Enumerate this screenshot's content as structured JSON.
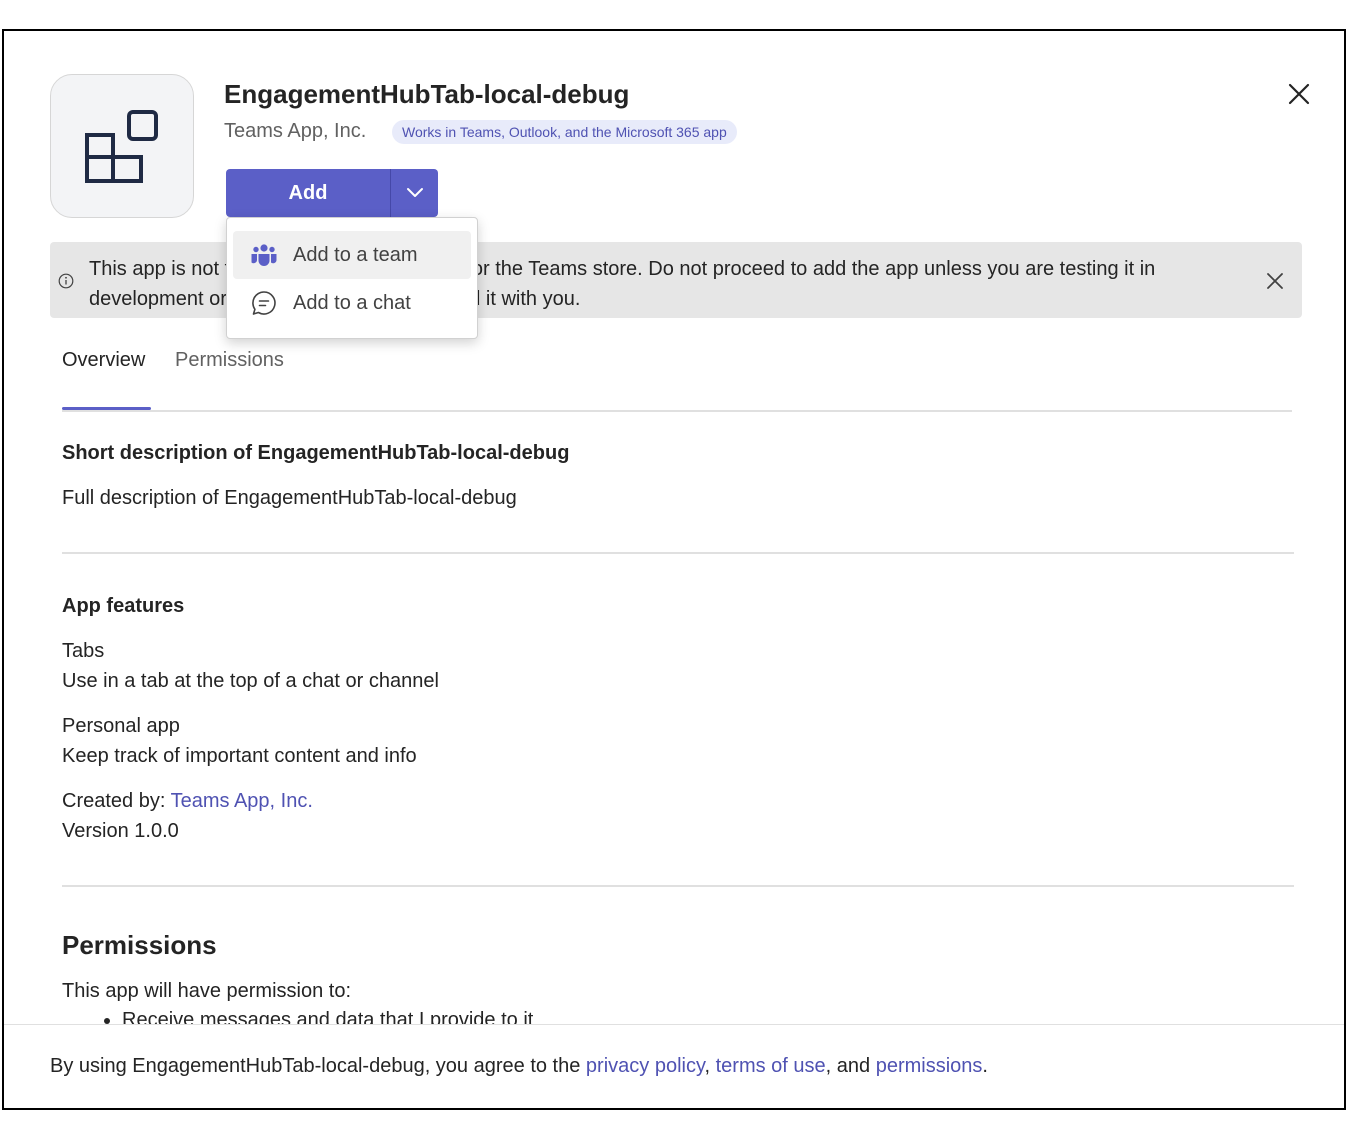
{
  "app": {
    "title": "EngagementHubTab-local-debug",
    "publisher": "Teams App, Inc.",
    "badge": "Works in Teams, Outlook, and the Microsoft 365 app",
    "icon": "app-grid-icon"
  },
  "actions": {
    "add_label": "Add",
    "dropdown_icon": "chevron-down-icon",
    "close_icon": "close-icon"
  },
  "menu": {
    "items": [
      {
        "label": "Add to a team",
        "icon": "team-icon"
      },
      {
        "label": "Add to a chat",
        "icon": "chat-icon"
      }
    ]
  },
  "banner": {
    "text": "This app is not from your org's app catalog or the Teams store. Do not proceed to add the app unless you are testing it in development or trust the person who shared it with you.",
    "icon": "info-icon",
    "close_icon": "close-icon"
  },
  "tabs": [
    {
      "label": "Overview",
      "selected": true
    },
    {
      "label": "Permissions",
      "selected": false
    }
  ],
  "overview": {
    "short_description": "Short description of EngagementHubTab-local-debug",
    "full_description": "Full description of EngagementHubTab-local-debug",
    "features_heading": "App features",
    "features": [
      {
        "name": "Tabs",
        "description": "Use in a tab at the top of a chat or channel"
      },
      {
        "name": "Personal app",
        "description": "Keep track of important content and info"
      }
    ],
    "created_by_label": "Created by:",
    "created_by_value": "Teams App, Inc.",
    "version": "Version 1.0.0"
  },
  "permissions": {
    "heading": "Permissions",
    "intro": "This app will have permission to:",
    "items": [
      "Receive messages and data that I provide to it"
    ]
  },
  "footer": {
    "prefix": "By using EngagementHubTab-local-debug, you agree to the ",
    "privacy_link": "privacy policy",
    "comma": ", ",
    "terms_link": "terms of use",
    "and": ", and ",
    "permissions_link": "permissions",
    "period": "."
  },
  "colors": {
    "accent": "#5b5fc7",
    "link": "#4f52b2",
    "banner_bg": "#e6e6e6"
  }
}
